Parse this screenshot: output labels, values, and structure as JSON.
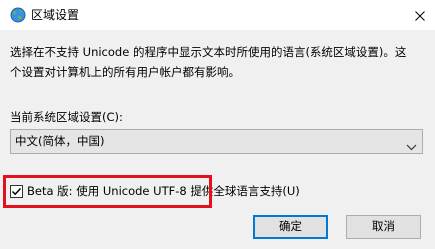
{
  "window": {
    "title": "区域设置",
    "icon": "globe-icon",
    "close_icon": "close-icon"
  },
  "description": {
    "line1": "选择在不支持 Unicode 的程序中显示文本时所使用的语言(系统区域设置)。这",
    "line2": "个设置对计算机上的所有用户帐户都有影响。"
  },
  "locale": {
    "label": "当前系统区域设置(C):",
    "selected": "中文(简体，中国)",
    "chevron_icon": "chevron-down-icon"
  },
  "beta": {
    "checked": true,
    "label": "Beta 版: 使用 Unicode UTF-8 提供全球语言支持(U)",
    "highlight_color": "#e3101d"
  },
  "buttons": {
    "ok": "确定",
    "cancel": "取消"
  },
  "colors": {
    "accent": "#0078d7",
    "titlebar": "#ffffff",
    "dialog_bg": "#f0f0f0"
  }
}
